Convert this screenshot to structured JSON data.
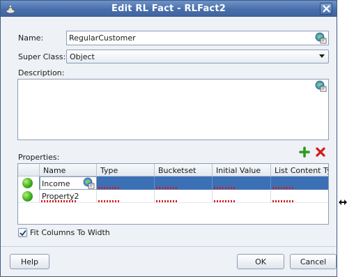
{
  "window": {
    "title": "Edit RL Fact - RLFact2"
  },
  "form": {
    "name_label": "Name:",
    "name_value": "RegularCustomer",
    "super_class_label": "Super Class:",
    "super_class_value": "Object",
    "description_label": "Description:",
    "description_value": ""
  },
  "properties": {
    "label": "Properties:",
    "columns": [
      "Name",
      "Type",
      "Bucketset",
      "Initial Value",
      "List Content Ty"
    ],
    "rows": [
      {
        "name": "Income",
        "type": "",
        "bucketset": "",
        "initial_value": "",
        "list_content_type": "",
        "selected": true
      },
      {
        "name": "Property2",
        "type": "",
        "bucketset": "",
        "initial_value": "",
        "list_content_type": "",
        "selected": false
      }
    ]
  },
  "fit_columns": {
    "label": "Fit Columns To Width",
    "checked": true
  },
  "buttons": {
    "help": "Help",
    "ok": "OK",
    "cancel": "Cancel"
  },
  "colors": {
    "title_bar": "#4a70ac",
    "selection": "#3b6fb6",
    "status_ok": "#3fae1f",
    "add": "#2d9a1b",
    "delete": "#d21a1a"
  }
}
